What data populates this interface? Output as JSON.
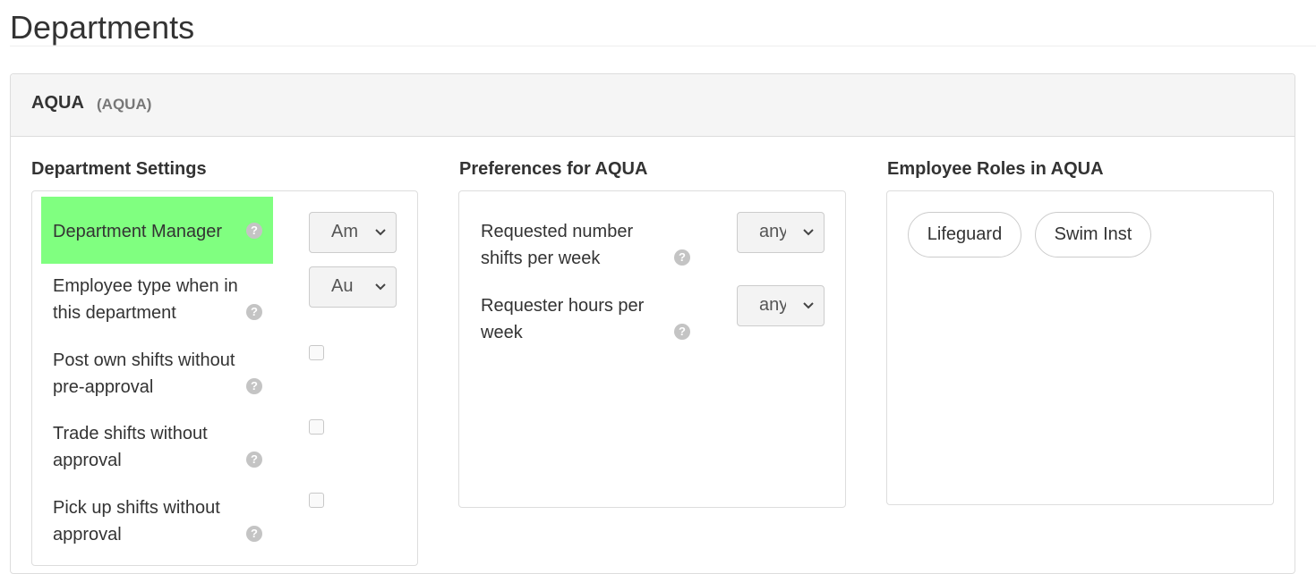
{
  "page": {
    "title": "Departments"
  },
  "department": {
    "name": "AQUA",
    "code": "(AQUA)"
  },
  "settings": {
    "title": "Department Settings",
    "rows": [
      {
        "label": "Department Manager",
        "control": "select",
        "value": "Am"
      },
      {
        "label": "Employee type when in this department",
        "control": "select",
        "value": "Au"
      },
      {
        "label": "Post own shifts without pre-approval",
        "control": "checkbox",
        "checked": false
      },
      {
        "label": "Trade shifts without approval",
        "control": "checkbox",
        "checked": false
      },
      {
        "label": "Pick up shifts without approval",
        "control": "checkbox",
        "checked": false
      }
    ]
  },
  "preferences": {
    "title": "Preferences for AQUA",
    "rows": [
      {
        "label": "Requested number shifts per week",
        "value": "any"
      },
      {
        "label": "Requester hours per week",
        "value": "any"
      }
    ]
  },
  "roles": {
    "title": "Employee Roles in AQUA",
    "items": [
      "Lifeguard",
      "Swim Inst"
    ]
  },
  "icons": {
    "help": "question-circle-icon",
    "dropdown": "chevron-down-icon"
  },
  "colors": {
    "highlight": "#80ff80",
    "header_bg": "#f5f5f5",
    "help_icon": "#c4c4c4"
  }
}
